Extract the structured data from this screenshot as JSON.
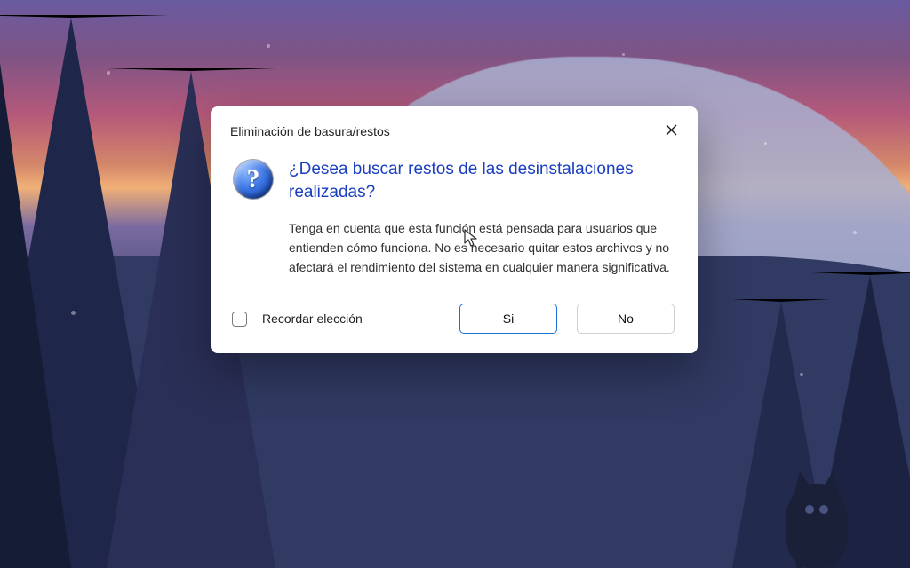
{
  "dialog": {
    "title": "Eliminación de basura/restos",
    "heading": "¿Desea buscar restos de las desinstalaciones realizadas?",
    "description": "Tenga en cuenta que esta función está pensada para usuarios que entienden cómo funciona. No es necesario quitar estos archivos y no afectará el rendimiento del sistema en cualquier manera significativa.",
    "remember_label": "Recordar elección",
    "yes_label": "Si",
    "no_label": "No",
    "icon_glyph": "?"
  }
}
